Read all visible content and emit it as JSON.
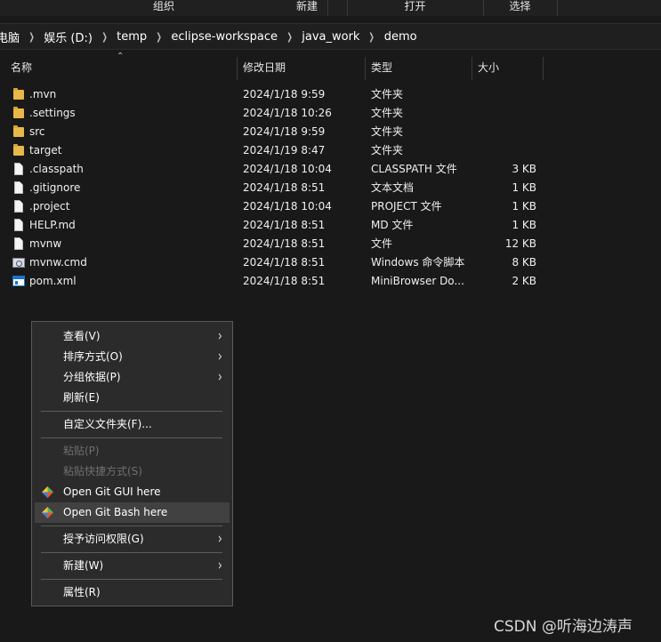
{
  "ribbon": {
    "groups": [
      "组织",
      "新建",
      "打开",
      "选择"
    ]
  },
  "address": {
    "crumbs": [
      "电脑",
      "娱乐 (D:)",
      "temp",
      "eclipse-workspace",
      "java_work",
      "demo"
    ]
  },
  "columns": {
    "name": "名称",
    "date": "修改日期",
    "type": "类型",
    "size": "大小"
  },
  "files": [
    {
      "name": ".mvn",
      "date": "2024/1/18 9:59",
      "type": "文件夹",
      "size": "",
      "icon": "folder-icon"
    },
    {
      "name": ".settings",
      "date": "2024/1/18 10:26",
      "type": "文件夹",
      "size": "",
      "icon": "folder-icon"
    },
    {
      "name": "src",
      "date": "2024/1/18 9:59",
      "type": "文件夹",
      "size": "",
      "icon": "folder-icon"
    },
    {
      "name": "target",
      "date": "2024/1/19 8:47",
      "type": "文件夹",
      "size": "",
      "icon": "folder-icon"
    },
    {
      "name": ".classpath",
      "date": "2024/1/18 10:04",
      "type": "CLASSPATH 文件",
      "size": "3 KB",
      "icon": "file-icon"
    },
    {
      "name": ".gitignore",
      "date": "2024/1/18 8:51",
      "type": "文本文档",
      "size": "1 KB",
      "icon": "file-icon"
    },
    {
      "name": ".project",
      "date": "2024/1/18 10:04",
      "type": "PROJECT 文件",
      "size": "1 KB",
      "icon": "file-icon"
    },
    {
      "name": "HELP.md",
      "date": "2024/1/18 8:51",
      "type": "MD 文件",
      "size": "1 KB",
      "icon": "file-icon"
    },
    {
      "name": "mvnw",
      "date": "2024/1/18 8:51",
      "type": "文件",
      "size": "12 KB",
      "icon": "file-icon"
    },
    {
      "name": "mvnw.cmd",
      "date": "2024/1/18 8:51",
      "type": "Windows 命令脚本",
      "size": "8 KB",
      "icon": "script-icon"
    },
    {
      "name": "pom.xml",
      "date": "2024/1/18 8:51",
      "type": "MiniBrowser Do...",
      "size": "2 KB",
      "icon": "xml-icon"
    }
  ],
  "context_menu": {
    "view": "查看(V)",
    "sort": "排序方式(O)",
    "group": "分组依据(P)",
    "refresh": "刷新(E)",
    "customize": "自定义文件夹(F)...",
    "paste": "粘贴(P)",
    "paste_shortcut": "粘贴快捷方式(S)",
    "git_gui": "Open Git GUI here",
    "git_bash": "Open Git Bash here",
    "give_access": "授予访问权限(G)",
    "new": "新建(W)",
    "properties": "属性(R)"
  },
  "watermark": "CSDN @听海边涛声",
  "colors": {
    "background": "#191919",
    "menu_bg": "#2b2b2b",
    "folder": "#e8b84a",
    "git_orange": "#f05133"
  }
}
